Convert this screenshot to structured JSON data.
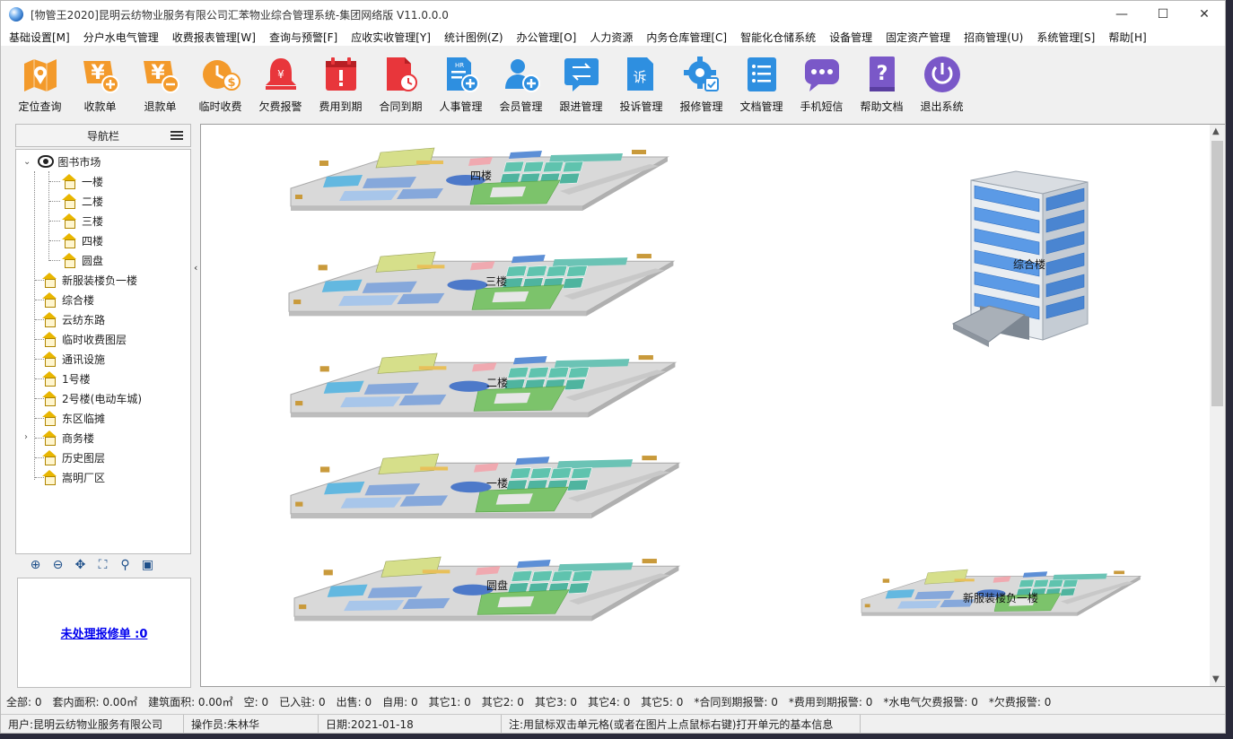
{
  "window": {
    "title": "[物管王2020]昆明云纺物业服务有限公司汇苯物业综合管理系统-集团网络版 V11.0.0.0",
    "controls": [
      "—",
      "☐",
      "✕"
    ]
  },
  "menubar": [
    "基础设置[M]",
    "分户水电气管理",
    "收费报表管理[W]",
    "查询与预警[F]",
    "应收实收管理[Y]",
    "统计图例(Z)",
    "办公管理[O]",
    "人力资源",
    "内务仓库管理[C]",
    "智能化仓储系统",
    "设备管理",
    "固定资产管理",
    "招商管理(U)",
    "系统管理[S]",
    "帮助[H]"
  ],
  "toolbar": [
    {
      "label": "定位查询",
      "icon": "map-location-icon",
      "color": "#f39a2b"
    },
    {
      "label": "收款单",
      "icon": "yen-plus-icon",
      "color": "#f39a2b"
    },
    {
      "label": "退款单",
      "icon": "yen-minus-icon",
      "color": "#f39a2b"
    },
    {
      "label": "临时收费",
      "icon": "clock-money-icon",
      "color": "#f39a2b"
    },
    {
      "label": "欠费报警",
      "icon": "alarm-bell-icon",
      "color": "#e8363b"
    },
    {
      "label": "费用到期",
      "icon": "calendar-alert-icon",
      "color": "#e8363b"
    },
    {
      "label": "合同到期",
      "icon": "contract-clock-icon",
      "color": "#e8363b"
    },
    {
      "label": "人事管理",
      "icon": "hr-document-icon",
      "color": "#2e8fe0"
    },
    {
      "label": "会员管理",
      "icon": "member-add-icon",
      "color": "#2e8fe0"
    },
    {
      "label": "跟进管理",
      "icon": "follow-up-icon",
      "color": "#2e8fe0"
    },
    {
      "label": "投诉管理",
      "icon": "complaint-icon",
      "color": "#2e8fe0"
    },
    {
      "label": "报修管理",
      "icon": "repair-gear-icon",
      "color": "#2e8fe0"
    },
    {
      "label": "文档管理",
      "icon": "document-list-icon",
      "color": "#2e8fe0"
    },
    {
      "label": "手机短信",
      "icon": "sms-bubble-icon",
      "color": "#7a58c8"
    },
    {
      "label": "帮助文档",
      "icon": "help-book-icon",
      "color": "#7a58c8"
    },
    {
      "label": "退出系统",
      "icon": "power-icon",
      "color": "#7a58c8"
    }
  ],
  "nav": {
    "header": "导航栏",
    "root": "图书市场",
    "children": [
      "一楼",
      "二楼",
      "三楼",
      "四楼",
      "圆盘"
    ],
    "items": [
      "新服装楼负一楼",
      "综合楼",
      "云纺东路",
      "临时收费图层",
      "通讯设施",
      "1号楼",
      "2号楼(电动车城)",
      "东区临摊",
      "商务楼",
      "历史图层",
      "嵩明厂区"
    ],
    "repair_link": "未处理报修单 :0"
  },
  "map": {
    "floors": [
      "四楼",
      "三楼",
      "二楼",
      "一楼",
      "圆盘",
      "新服装楼负一楼"
    ],
    "building_label": "综合楼"
  },
  "status": {
    "stats": [
      "全部: 0",
      "套内面积: 0.00㎡",
      "建筑面积: 0.00㎡",
      "空: 0",
      "已入驻: 0",
      "出售: 0",
      "自用: 0",
      "其它1: 0",
      "其它2: 0",
      "其它3: 0",
      "其它4: 0",
      "其它5: 0",
      "*合同到期报警: 0",
      "*费用到期报警: 0",
      "*水电气欠费报警: 0",
      "*欠费报警: 0"
    ],
    "user": "用户:昆明云纺物业服务有限公司",
    "operator": "操作员:朱林华",
    "date": "日期:2021-01-18",
    "hint": "注:用鼠标双击单元格(或者在图片上点鼠标右键)打开单元的基本信息"
  },
  "colors": {
    "orange": "#f39a2b",
    "red": "#e8363b",
    "blue": "#2e8fe0",
    "purple": "#7a58c8",
    "link": "#0000ee"
  }
}
